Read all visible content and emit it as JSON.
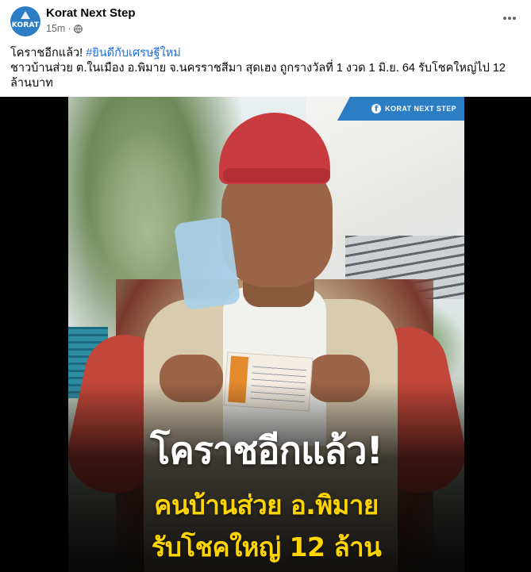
{
  "post": {
    "page_name": "Korat Next Step",
    "avatar_text": "KORAT",
    "time": "15m",
    "dot": "·",
    "privacy_icon": "globe-icon",
    "more_icon": "more-horizontal-icon",
    "text_line1_plain": "โคราชอีกแล้ว! ",
    "hashtag": "#ยินดีกับเศรษฐีใหม่",
    "text_body": "ชาวบ้านส่วย ต.ในเมือง อ.พิมาย จ.นครราชสีมา สุดเฮง ถูกรางวัลที่ 1 งวด 1 มิ.ย. 64 รับโชคใหญ่ไป 12 ล้านบาท"
  },
  "image": {
    "brand_banner": "KORAT NEXT STEP",
    "fb_glyph": "f",
    "headline": "โคราชอีกแล้ว!",
    "subline1": "คนบ้านส่วย อ.พิมาย",
    "subline2": "รับโชคใหญ่ 12 ล้าน"
  },
  "colors": {
    "link": "#216fdb",
    "brand_blue": "#2b7ec4",
    "headline_yellow": "#ffd500",
    "meta_gray": "#65676b"
  }
}
